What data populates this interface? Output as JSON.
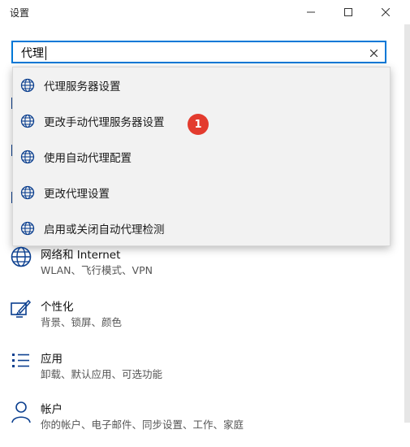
{
  "window": {
    "title": "设置"
  },
  "search": {
    "value": "代理"
  },
  "suggestions": [
    {
      "label": "代理服务器设置",
      "icon": "globe-icon"
    },
    {
      "label": "更改手动代理服务器设置",
      "icon": "globe-icon"
    },
    {
      "label": "使用自动代理配置",
      "icon": "globe-icon"
    },
    {
      "label": "更改代理设置",
      "icon": "globe-icon"
    },
    {
      "label": "启用或关闭自动代理检测",
      "icon": "globe-icon"
    }
  ],
  "annotation": {
    "badge": "1"
  },
  "categories": [
    {
      "name": "网络和 Internet",
      "description": "WLAN、飞行模式、VPN",
      "icon": "globe-icon"
    },
    {
      "name": "个性化",
      "description": "背景、锁屏、颜色",
      "icon": "personalize-icon"
    },
    {
      "name": "应用",
      "description": "卸载、默认应用、可选功能",
      "icon": "apps-list-icon"
    },
    {
      "name": "帐户",
      "description": "你的帐户、电子邮件、同步设置、工作、家庭",
      "icon": "person-icon"
    }
  ],
  "colors": {
    "accent": "#0078d7",
    "badge": "#e33b2e",
    "icon_blue": "#0b3f8f"
  }
}
